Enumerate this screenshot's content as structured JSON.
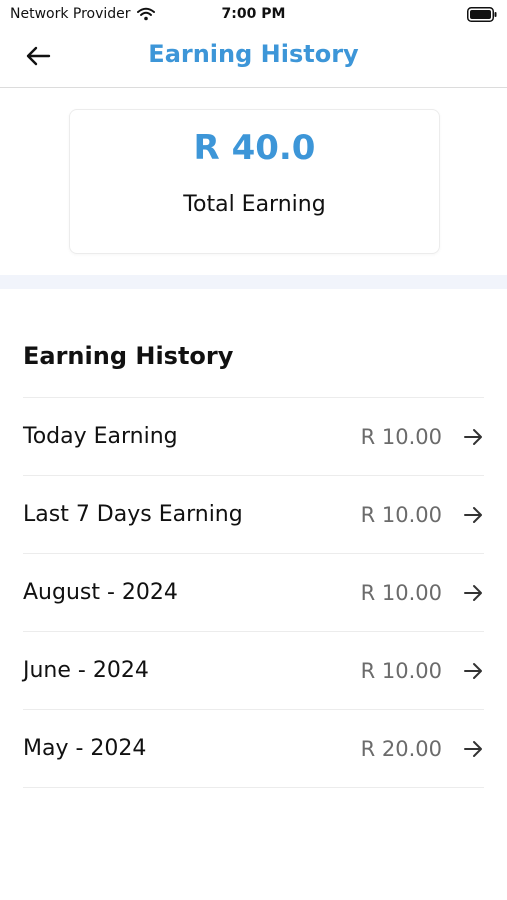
{
  "status_bar": {
    "carrier": "Network Provider",
    "time": "7:00 PM"
  },
  "header": {
    "title": "Earning History",
    "back_icon": "arrow-left-icon"
  },
  "summary": {
    "amount": "R 40.0",
    "label": "Total Earning"
  },
  "section": {
    "title": "Earning History"
  },
  "items": [
    {
      "label": "Today Earning",
      "amount": "R 10.00"
    },
    {
      "label": "Last 7 Days Earning",
      "amount": "R 10.00"
    },
    {
      "label": "August - 2024",
      "amount": "R 10.00"
    },
    {
      "label": "June - 2024",
      "amount": "R 10.00"
    },
    {
      "label": "May - 2024",
      "amount": "R 20.00"
    }
  ],
  "colors": {
    "accent": "#3d96d8",
    "muted_text": "#6b6b6b",
    "band": "#f1f4fb"
  }
}
